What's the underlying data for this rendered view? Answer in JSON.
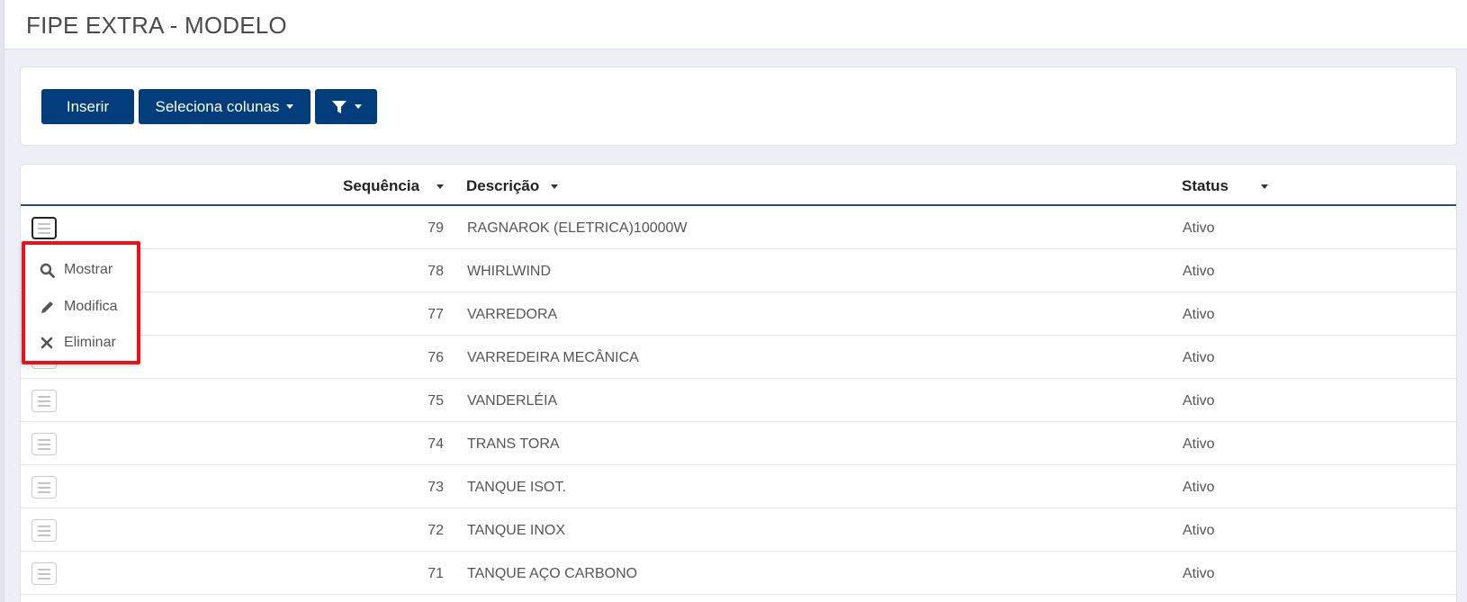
{
  "page": {
    "title": "FIPE EXTRA - MODELO"
  },
  "toolbar": {
    "insert_label": "Inserir",
    "columns_label": "Seleciona colunas",
    "filter_icon": "filter-icon"
  },
  "table": {
    "columns": [
      {
        "label": "Sequência",
        "sortable": true
      },
      {
        "label": "Descrição",
        "sortable": true
      },
      {
        "label": "Status",
        "sortable": true
      }
    ],
    "rows": [
      {
        "seq": "79",
        "desc": "RAGNAROK (ELETRICA)10000W",
        "status": "Ativo"
      },
      {
        "seq": "78",
        "desc": "WHIRLWIND",
        "status": "Ativo"
      },
      {
        "seq": "77",
        "desc": "VARREDORA",
        "status": "Ativo"
      },
      {
        "seq": "76",
        "desc": "VARREDEIRA MECÂNICA",
        "status": "Ativo"
      },
      {
        "seq": "75",
        "desc": "VANDERLÉIA",
        "status": "Ativo"
      },
      {
        "seq": "74",
        "desc": "TRANS TORA",
        "status": "Ativo"
      },
      {
        "seq": "73",
        "desc": "TANQUE ISOT.",
        "status": "Ativo"
      },
      {
        "seq": "72",
        "desc": "TANQUE INOX",
        "status": "Ativo"
      },
      {
        "seq": "71",
        "desc": "TANQUE AÇO CARBONO",
        "status": "Ativo"
      }
    ]
  },
  "row_menu": {
    "items": [
      {
        "label": "Mostrar",
        "icon": "search-icon"
      },
      {
        "label": "Modifica",
        "icon": "pencil-icon"
      },
      {
        "label": "Eliminar",
        "icon": "close-icon"
      }
    ]
  },
  "colors": {
    "primary": "#003d7a",
    "highlight": "#e8121b",
    "header_border": "#1f4e8c"
  }
}
